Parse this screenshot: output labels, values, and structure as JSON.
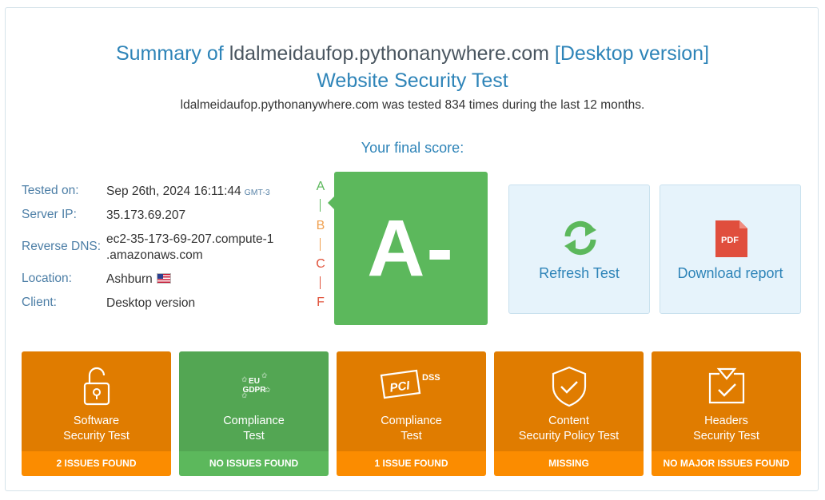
{
  "header": {
    "title_prefix": "Summary of",
    "domain": "ldalmeidaufop.pythonanywhere.com",
    "title_suffix": "[Desktop version]",
    "subtitle": "Website Security Test",
    "tested_summary": "ldalmeidaufop.pythonanywhere.com was tested 834 times during the last 12 months."
  },
  "score": {
    "label": "Your final score:",
    "grade": "A-",
    "scale": [
      "A",
      "B",
      "C",
      "F"
    ],
    "scale_colors": [
      "#5cb85c",
      "#f0a050",
      "#e0533c",
      "#e0533c"
    ],
    "grade_color": "#5cb85c"
  },
  "info": {
    "tested_on_label": "Tested on:",
    "tested_on_value": "Sep 26th, 2024 16:11:44",
    "tested_on_tz": "GMT-3",
    "server_ip_label": "Server IP:",
    "server_ip_value": "35.173.69.207",
    "reverse_dns_label": "Reverse DNS:",
    "reverse_dns_line1": "ec2-35-173-69-207.compute-1",
    "reverse_dns_line2": ".amazonaws.com",
    "location_label": "Location:",
    "location_value": "Ashburn",
    "location_flag_icon": "us-flag-icon",
    "client_label": "Client:",
    "client_value": "Desktop version"
  },
  "actions": {
    "refresh_label": "Refresh Test",
    "refresh_icon": "refresh-icon",
    "download_label": "Download report",
    "download_icon": "pdf-file-icon",
    "pdf_badge": "PDF"
  },
  "tiles": [
    {
      "line1": "Software",
      "line2": "Security Test",
      "status": "2 ISSUES FOUND",
      "icon": "unlock-icon",
      "color": "orange"
    },
    {
      "line1": "Compliance",
      "line2": "Test",
      "status": "NO ISSUES FOUND",
      "icon": "eu-gdpr-icon",
      "color": "green",
      "icon_text1": "EU",
      "icon_text2": "GDPR"
    },
    {
      "line1": "Compliance",
      "line2": "Test",
      "status": "1 ISSUE FOUND",
      "icon": "pci-dss-icon",
      "color": "orange",
      "icon_text1": "PCI",
      "icon_text2": "DSS"
    },
    {
      "line1": "Content",
      "line2": "Security Policy Test",
      "status": "MISSING",
      "icon": "shield-check-icon",
      "color": "orange"
    },
    {
      "line1": "Headers",
      "line2": "Security Test",
      "status": "NO MAJOR ISSUES FOUND",
      "icon": "headers-check-icon",
      "color": "orange"
    }
  ],
  "colors": {
    "accent_blue": "#2e84b8",
    "orange": "#e07c00",
    "orange_footer": "#fb8c00",
    "green": "#53a653",
    "green_footer": "#5cb85c",
    "action_bg": "#e6f3fb"
  }
}
